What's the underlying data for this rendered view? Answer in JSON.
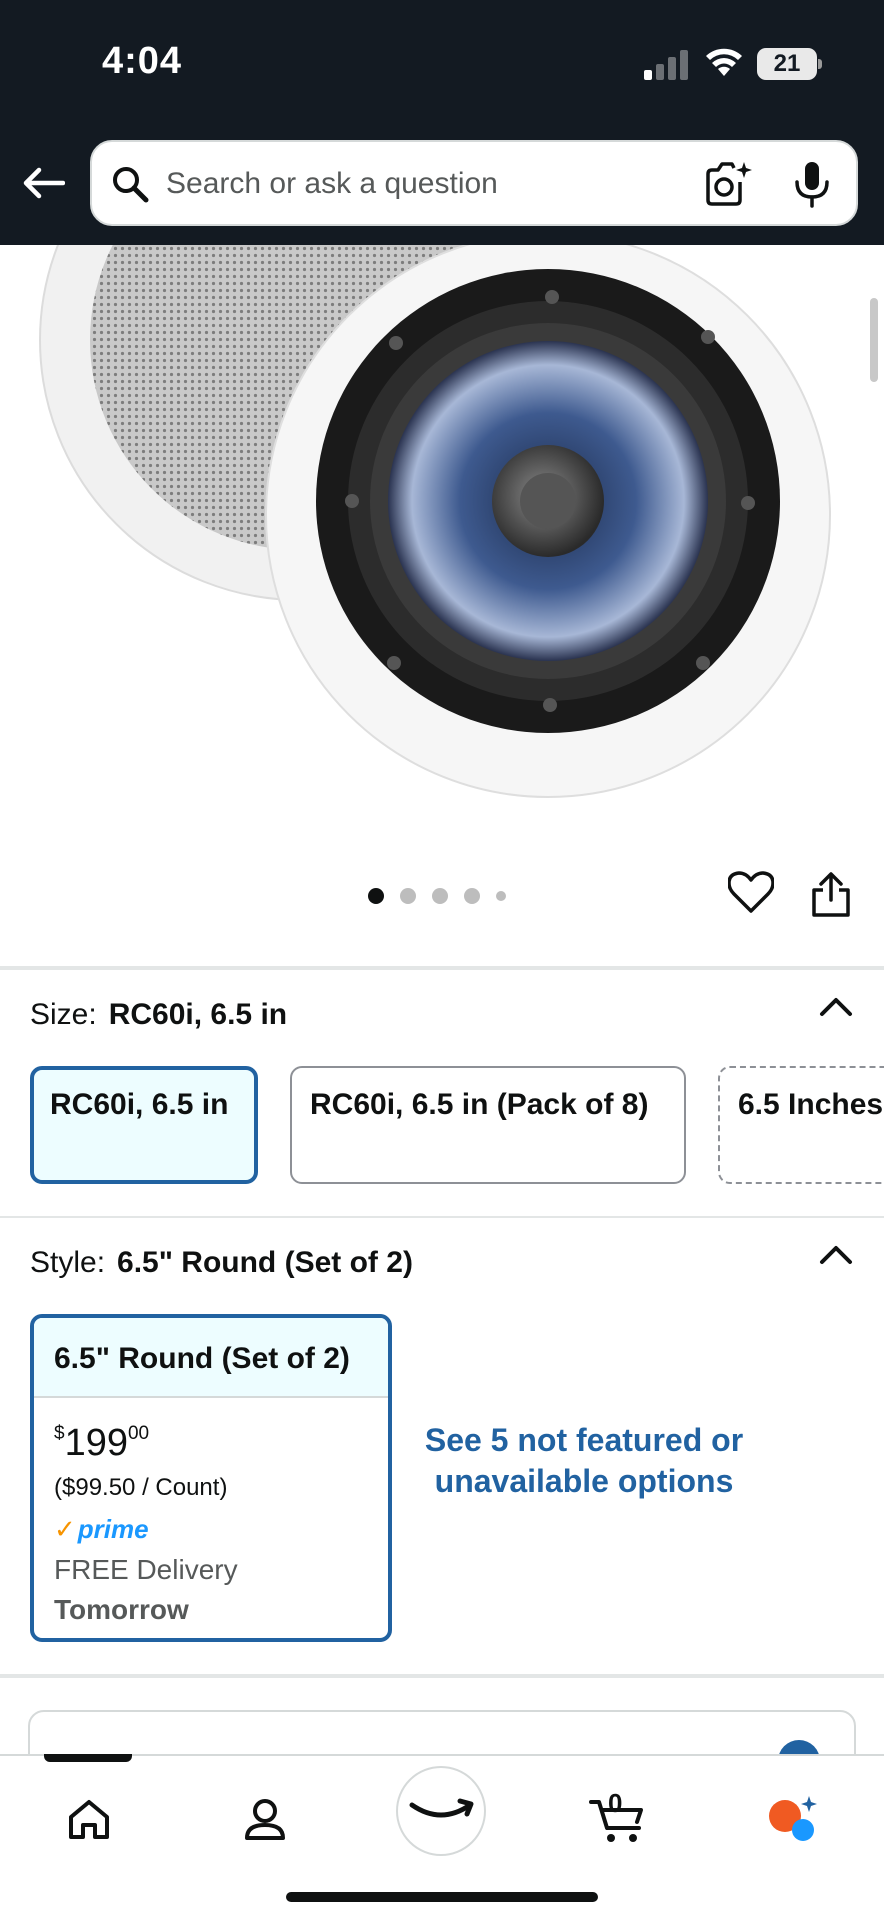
{
  "status_bar": {
    "time": "4:04",
    "battery_level": "21"
  },
  "header": {
    "search_placeholder": "Search or ask a question"
  },
  "gallery": {
    "image_count": 5,
    "active_index": 0
  },
  "size_section": {
    "label": "Size:",
    "selected_value": "RC60i, 6.5 in",
    "options": [
      {
        "label": "RC60i, 6.5 in",
        "selected": true
      },
      {
        "label": "RC60i, 6.5 in (Pack of 8)",
        "selected": false
      },
      {
        "label": "6.5 Inches",
        "selected": false
      }
    ]
  },
  "style_section": {
    "label": "Style:",
    "selected_value": "6.5\" Round (Set of 2)",
    "card": {
      "title": "6.5\" Round (Set of 2)",
      "currency": "$",
      "price_whole": "199",
      "price_fraction": "00",
      "per_count": "($99.50 / Count)",
      "prime_label": "prime",
      "delivery": "FREE Delivery",
      "delivery_day": "Tomorrow"
    },
    "see_more": "See 5 not featured or unavailable options"
  },
  "bottom_nav": {
    "cart_count": "0"
  },
  "colors": {
    "header_bg": "#131a22",
    "accent_blue": "#2162a1",
    "prime_blue": "#1a98ff",
    "prime_check": "#f79400"
  }
}
